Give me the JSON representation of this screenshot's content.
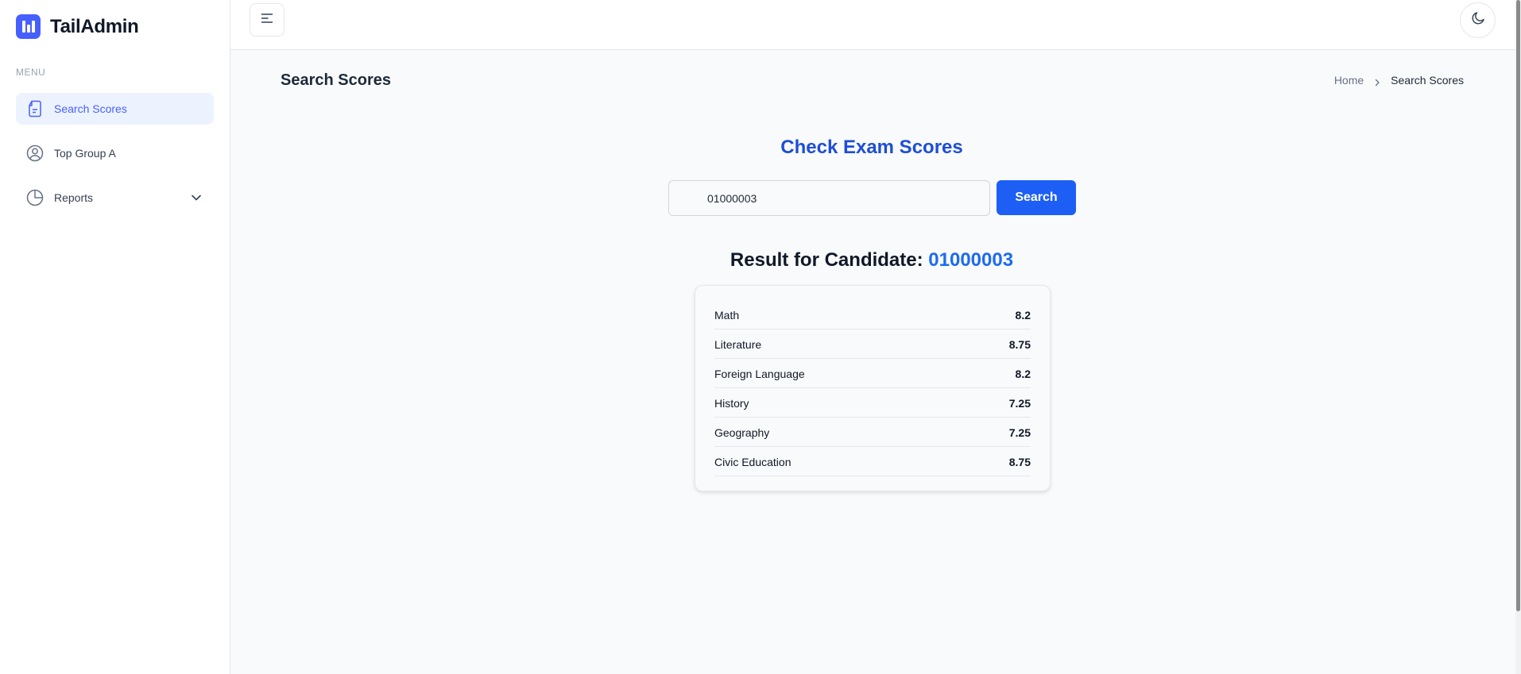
{
  "app": {
    "name": "TailAdmin"
  },
  "sidebar": {
    "menu_title": "MENU",
    "items": [
      {
        "label": "Search Scores",
        "icon": "document-icon",
        "active": true
      },
      {
        "label": "Top Group A",
        "icon": "user-circle-icon",
        "active": false
      },
      {
        "label": "Reports",
        "icon": "pie-chart-icon",
        "active": false,
        "expandable": true
      }
    ]
  },
  "header": {
    "toggle_icon": "menu-toggle-icon",
    "theme_icon": "moon-icon"
  },
  "page": {
    "title": "Search Scores",
    "breadcrumb": {
      "home": "Home",
      "current": "Search Scores"
    }
  },
  "search": {
    "heading": "Check Exam Scores",
    "input_value": "01000003",
    "button_label": "Search"
  },
  "result": {
    "label": "Result for Candidate: ",
    "candidate_id": "01000003",
    "scores": [
      {
        "subject": "Math",
        "score": "8.2"
      },
      {
        "subject": "Literature",
        "score": "8.75"
      },
      {
        "subject": "Foreign Language",
        "score": "8.2"
      },
      {
        "subject": "History",
        "score": "7.25"
      },
      {
        "subject": "Geography",
        "score": "7.25"
      },
      {
        "subject": "Civic Education",
        "score": "8.75"
      }
    ]
  },
  "colors": {
    "brand": "#465fff",
    "primary_button": "#1d5ff5",
    "heading_blue": "#1d4ed8",
    "candidate_blue": "#1d6bf0"
  }
}
